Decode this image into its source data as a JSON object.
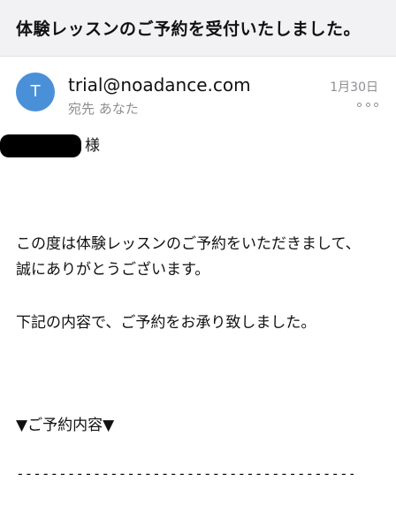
{
  "subject": "体験レッスンのご予約を受付いたしました。",
  "header": {
    "avatar_initial": "T",
    "sender": "trial@noadance.com",
    "recipient": "宛先 あなた",
    "date": "1月30日",
    "more_icon": "more-horizontal-icon"
  },
  "body": {
    "greeting_suffix": "様",
    "paragraph1": "この度は体験レッスンのご予約をいただきまして、誠にありがとうございます。",
    "paragraph2": "下記の内容で、ご予約をお承り致しました。",
    "section_title": "▼ご予約内容▼",
    "divider": "-------------------------------------------"
  },
  "colors": {
    "avatar": "#4a90d9",
    "subject_bar": "#f2f2f4",
    "muted_text": "#8e8e93"
  }
}
